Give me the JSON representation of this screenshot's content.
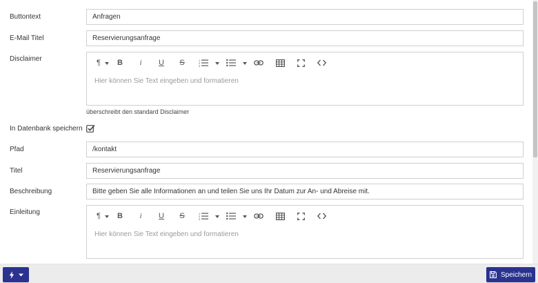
{
  "fields": {
    "buttontext": {
      "label": "Buttontext",
      "value": "Anfragen"
    },
    "email_title": {
      "label": "E-Mail Titel",
      "value": "Reservierungsanfrage"
    },
    "disclaimer": {
      "label": "Disclaimer",
      "placeholder": "Hier können Sie Text eingeben und formatieren",
      "hint": "überschreibt den standard Disclaimer"
    },
    "save_db": {
      "label": "In Datenbank speichern",
      "checked": true
    },
    "path": {
      "label": "Pfad",
      "value": "/kontakt"
    },
    "title": {
      "label": "Titel",
      "value": "Reservierungsanfrage"
    },
    "description": {
      "label": "Beschreibung",
      "value": "Bitte geben Sie alle Informationen an und teilen Sie uns Ihr Datum zur An- und Abreise mit."
    },
    "intro": {
      "label": "Einleitung",
      "placeholder": "Hier können Sie Text eingeben und formatieren"
    }
  },
  "toolbar": {
    "paragraph_glyph": "¶",
    "bold_glyph": "B",
    "italic_glyph": "i",
    "underline_glyph": "U",
    "strike_glyph": "S",
    "code_glyph": "<>"
  },
  "footer": {
    "save_label": "Speichern"
  },
  "colors": {
    "accent": "#2a3290",
    "border": "#cfcfcf",
    "bottom_bar": "#ececec"
  }
}
